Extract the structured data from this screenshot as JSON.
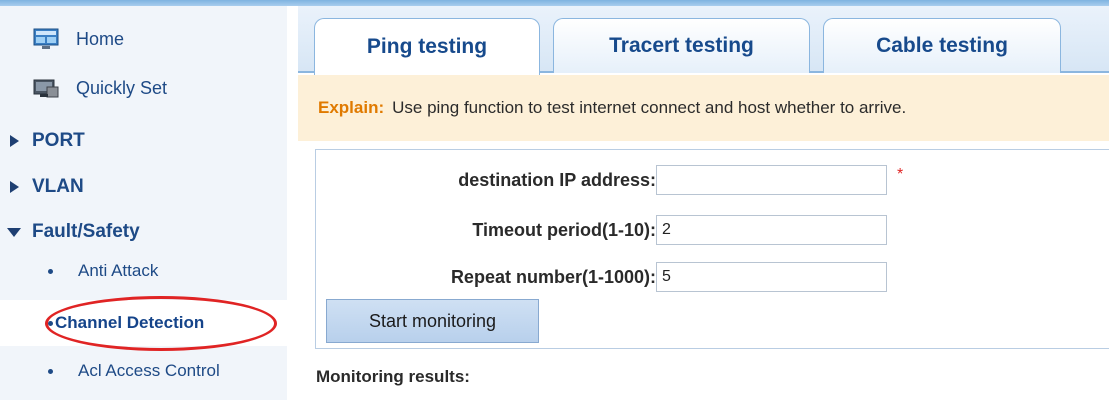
{
  "sidebar": {
    "home": "Home",
    "quick_set": "Quickly Set",
    "port": "PORT",
    "vlan": "VLAN",
    "fault_safety": "Fault/Safety",
    "sub_items": [
      "Anti Attack",
      "Channel Detection",
      "Acl Access Control"
    ]
  },
  "tabs": [
    {
      "label": "Ping testing",
      "active": true
    },
    {
      "label": "Tracert testing",
      "active": false
    },
    {
      "label": "Cable testing",
      "active": false
    }
  ],
  "explain": {
    "label": "Explain:",
    "text": "Use ping function to test internet connect and host whether to arrive."
  },
  "form": {
    "destination_label": "destination IP address:",
    "destination_value": "",
    "required_mark": "*",
    "timeout_label": "Timeout period(1-10):",
    "timeout_value": "2",
    "repeat_label": "Repeat number(1-1000):",
    "repeat_value": "5",
    "start_button": "Start monitoring"
  },
  "results": {
    "label": "Monitoring results:"
  },
  "colors": {
    "accent_blue": "#1e4a86",
    "explain_bg": "#fdf0d8",
    "explain_label": "#e07a00",
    "annotation_red": "#e02424"
  }
}
